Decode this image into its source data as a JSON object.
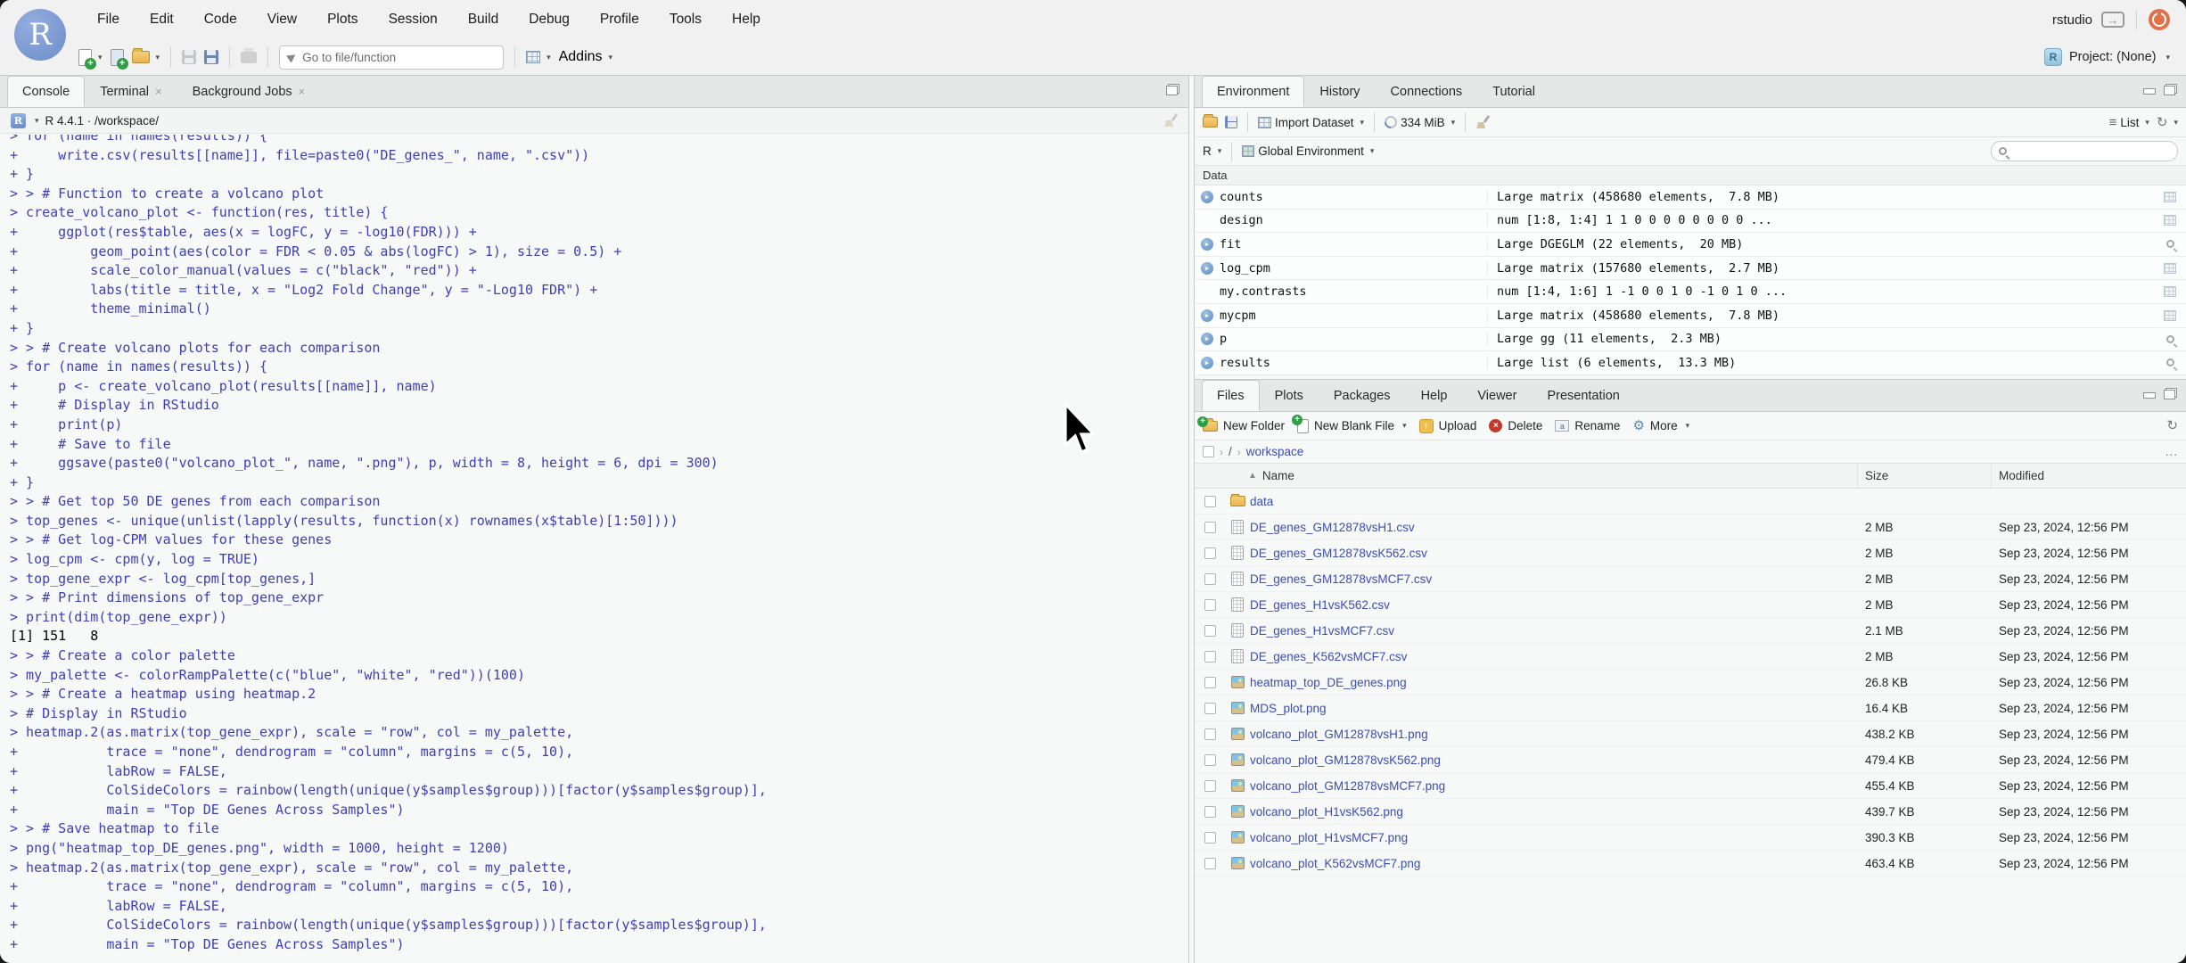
{
  "menubar": {
    "items": [
      "File",
      "Edit",
      "Code",
      "View",
      "Plots",
      "Session",
      "Build",
      "Debug",
      "Profile",
      "Tools",
      "Help"
    ]
  },
  "titlebar": {
    "username": "rstudio",
    "project_label": "Project: (None)"
  },
  "toolbar": {
    "goto_placeholder": "Go to file/function",
    "addins_label": "Addins"
  },
  "console_pane": {
    "tabs": [
      {
        "label": "Console",
        "active": true,
        "closable": false
      },
      {
        "label": "Terminal",
        "active": false,
        "closable": true
      },
      {
        "label": "Background Jobs",
        "active": false,
        "closable": true
      }
    ],
    "version_line": "R 4.4.1 · /workspace/",
    "lines": [
      {
        "type": "input",
        "text": "> for (name in names(results)) {"
      },
      {
        "type": "input",
        "text": "+     write.csv(results[[name]], file=paste0(\"DE_genes_\", name, \".csv\"))"
      },
      {
        "type": "input",
        "text": "+ }"
      },
      {
        "type": "input",
        "text": "> > # Function to create a volcano plot"
      },
      {
        "type": "input",
        "text": "> create_volcano_plot <- function(res, title) {"
      },
      {
        "type": "input",
        "text": "+     ggplot(res$table, aes(x = logFC, y = -log10(FDR))) +"
      },
      {
        "type": "input",
        "text": "+         geom_point(aes(color = FDR < 0.05 & abs(logFC) > 1), size = 0.5) +"
      },
      {
        "type": "input",
        "text": "+         scale_color_manual(values = c(\"black\", \"red\")) +"
      },
      {
        "type": "input",
        "text": "+         labs(title = title, x = \"Log2 Fold Change\", y = \"-Log10 FDR\") +"
      },
      {
        "type": "input",
        "text": "+         theme_minimal()"
      },
      {
        "type": "input",
        "text": "+ }"
      },
      {
        "type": "input",
        "text": "> > # Create volcano plots for each comparison"
      },
      {
        "type": "input",
        "text": "> for (name in names(results)) {"
      },
      {
        "type": "input",
        "text": "+     p <- create_volcano_plot(results[[name]], name)"
      },
      {
        "type": "input",
        "text": "+     # Display in RStudio"
      },
      {
        "type": "input",
        "text": "+     print(p)"
      },
      {
        "type": "input",
        "text": "+     # Save to file"
      },
      {
        "type": "input",
        "text": "+     ggsave(paste0(\"volcano_plot_\", name, \".png\"), p, width = 8, height = 6, dpi = 300)"
      },
      {
        "type": "input",
        "text": "+ }"
      },
      {
        "type": "input",
        "text": "> > # Get top 50 DE genes from each comparison"
      },
      {
        "type": "input",
        "text": "> top_genes <- unique(unlist(lapply(results, function(x) rownames(x$table)[1:50])))"
      },
      {
        "type": "input",
        "text": "> > # Get log-CPM values for these genes"
      },
      {
        "type": "input",
        "text": "> log_cpm <- cpm(y, log = TRUE)"
      },
      {
        "type": "input",
        "text": "> top_gene_expr <- log_cpm[top_genes,]"
      },
      {
        "type": "input",
        "text": "> > # Print dimensions of top_gene_expr"
      },
      {
        "type": "input",
        "text": "> print(dim(top_gene_expr))"
      },
      {
        "type": "output",
        "text": "[1] 151   8"
      },
      {
        "type": "input",
        "text": "> > # Create a color palette"
      },
      {
        "type": "input",
        "text": "> my_palette <- colorRampPalette(c(\"blue\", \"white\", \"red\"))(100)"
      },
      {
        "type": "input",
        "text": "> > # Create a heatmap using heatmap.2"
      },
      {
        "type": "input",
        "text": "> # Display in RStudio"
      },
      {
        "type": "input",
        "text": "> heatmap.2(as.matrix(top_gene_expr), scale = \"row\", col = my_palette,"
      },
      {
        "type": "input",
        "text": "+           trace = \"none\", dendrogram = \"column\", margins = c(5, 10),"
      },
      {
        "type": "input",
        "text": "+           labRow = FALSE,"
      },
      {
        "type": "input",
        "text": "+           ColSideColors = rainbow(length(unique(y$samples$group)))[factor(y$samples$group)],"
      },
      {
        "type": "input",
        "text": "+           main = \"Top DE Genes Across Samples\")"
      },
      {
        "type": "input",
        "text": "> > # Save heatmap to file"
      },
      {
        "type": "input",
        "text": "> png(\"heatmap_top_DE_genes.png\", width = 1000, height = 1200)"
      },
      {
        "type": "input",
        "text": "> heatmap.2(as.matrix(top_gene_expr), scale = \"row\", col = my_palette,"
      },
      {
        "type": "input",
        "text": "+           trace = \"none\", dendrogram = \"column\", margins = c(5, 10),"
      },
      {
        "type": "input",
        "text": "+           labRow = FALSE,"
      },
      {
        "type": "input",
        "text": "+           ColSideColors = rainbow(length(unique(y$samples$group)))[factor(y$samples$group)],"
      },
      {
        "type": "input",
        "text": "+           main = \"Top DE Genes Across Samples\")"
      }
    ]
  },
  "environment_pane": {
    "tabs": [
      "Environment",
      "History",
      "Connections",
      "Tutorial"
    ],
    "active_tab": "Environment",
    "toolbar": {
      "import_dataset": "Import Dataset",
      "memory": "334 MiB",
      "list_label": "List"
    },
    "scope": {
      "language": "R",
      "environment": "Global Environment"
    },
    "section_header": "Data",
    "objects": [
      {
        "name": "counts",
        "value": "Large matrix (458680 elements,  7.8 MB)",
        "expandable": true,
        "action": "grid"
      },
      {
        "name": "design",
        "value": "num [1:8, 1:4] 1 1 0 0 0 0 0 0 0 0 ...",
        "expandable": false,
        "action": "grid"
      },
      {
        "name": "fit",
        "value": "Large DGEGLM (22 elements,  20 MB)",
        "expandable": true,
        "action": "inspect"
      },
      {
        "name": "log_cpm",
        "value": "Large matrix (157680 elements,  2.7 MB)",
        "expandable": true,
        "action": "grid"
      },
      {
        "name": "my.contrasts",
        "value": "num [1:4, 1:6] 1 -1 0 0 1 0 -1 0 1 0 ...",
        "expandable": false,
        "action": "grid"
      },
      {
        "name": "mycpm",
        "value": "Large matrix (458680 elements,  7.8 MB)",
        "expandable": true,
        "action": "grid"
      },
      {
        "name": "p",
        "value": "Large gg (11 elements,  2.3 MB)",
        "expandable": true,
        "action": "inspect"
      },
      {
        "name": "results",
        "value": "Large list (6 elements,  13.3 MB)",
        "expandable": true,
        "action": "inspect"
      }
    ]
  },
  "files_pane": {
    "tabs": [
      "Files",
      "Plots",
      "Packages",
      "Help",
      "Viewer",
      "Presentation"
    ],
    "active_tab": "Files",
    "toolbar": [
      {
        "label": "New Folder",
        "icon": "new-folder",
        "caret": false
      },
      {
        "label": "New Blank File",
        "icon": "new-file",
        "caret": true
      },
      {
        "label": "Upload",
        "icon": "upload",
        "caret": false
      },
      {
        "label": "Delete",
        "icon": "delete",
        "caret": false
      },
      {
        "label": "Rename",
        "icon": "rename",
        "caret": false
      },
      {
        "label": "More",
        "icon": "gear",
        "caret": true
      }
    ],
    "breadcrumb": [
      "/",
      "workspace"
    ],
    "breadcrumb_more": "...",
    "columns": [
      "Name",
      "Size",
      "Modified"
    ],
    "files": [
      {
        "name": "data",
        "type": "folder",
        "size": "",
        "modified": ""
      },
      {
        "name": "DE_genes_GM12878vsH1.csv",
        "type": "csv",
        "size": "2 MB",
        "modified": "Sep 23, 2024, 12:56 PM"
      },
      {
        "name": "DE_genes_GM12878vsK562.csv",
        "type": "csv",
        "size": "2 MB",
        "modified": "Sep 23, 2024, 12:56 PM"
      },
      {
        "name": "DE_genes_GM12878vsMCF7.csv",
        "type": "csv",
        "size": "2 MB",
        "modified": "Sep 23, 2024, 12:56 PM"
      },
      {
        "name": "DE_genes_H1vsK562.csv",
        "type": "csv",
        "size": "2 MB",
        "modified": "Sep 23, 2024, 12:56 PM"
      },
      {
        "name": "DE_genes_H1vsMCF7.csv",
        "type": "csv",
        "size": "2.1 MB",
        "modified": "Sep 23, 2024, 12:56 PM"
      },
      {
        "name": "DE_genes_K562vsMCF7.csv",
        "type": "csv",
        "size": "2 MB",
        "modified": "Sep 23, 2024, 12:56 PM"
      },
      {
        "name": "heatmap_top_DE_genes.png",
        "type": "png",
        "size": "26.8 KB",
        "modified": "Sep 23, 2024, 12:56 PM"
      },
      {
        "name": "MDS_plot.png",
        "type": "png",
        "size": "16.4 KB",
        "modified": "Sep 23, 2024, 12:56 PM"
      },
      {
        "name": "volcano_plot_GM12878vsH1.png",
        "type": "png",
        "size": "438.2 KB",
        "modified": "Sep 23, 2024, 12:56 PM"
      },
      {
        "name": "volcano_plot_GM12878vsK562.png",
        "type": "png",
        "size": "479.4 KB",
        "modified": "Sep 23, 2024, 12:56 PM"
      },
      {
        "name": "volcano_plot_GM12878vsMCF7.png",
        "type": "png",
        "size": "455.4 KB",
        "modified": "Sep 23, 2024, 12:56 PM"
      },
      {
        "name": "volcano_plot_H1vsK562.png",
        "type": "png",
        "size": "439.7 KB",
        "modified": "Sep 23, 2024, 12:56 PM"
      },
      {
        "name": "volcano_plot_H1vsMCF7.png",
        "type": "png",
        "size": "390.3 KB",
        "modified": "Sep 23, 2024, 12:56 PM"
      },
      {
        "name": "volcano_plot_K562vsMCF7.png",
        "type": "png",
        "size": "463.4 KB",
        "modified": "Sep 23, 2024, 12:56 PM"
      }
    ]
  },
  "colors": {
    "console_text": "#3e3eb8",
    "file_link": "#3b4db4",
    "chrome_bg": "#f1f1f1",
    "pane_bg": "#f7f8f8"
  }
}
